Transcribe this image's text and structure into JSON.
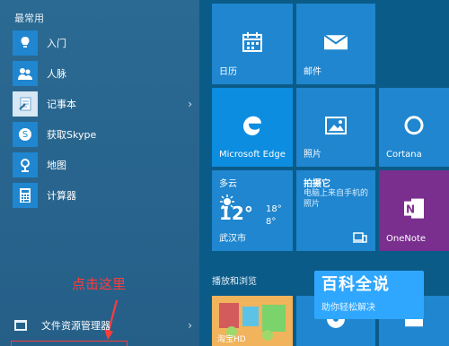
{
  "left": {
    "section_title": "最常用",
    "items": [
      {
        "label": "入门",
        "icon": "lightbulb-icon"
      },
      {
        "label": "人脉",
        "icon": "people-icon"
      },
      {
        "label": "记事本",
        "icon": "notepad-icon"
      },
      {
        "label": "获取Skype",
        "icon": "skype-icon"
      },
      {
        "label": "地图",
        "icon": "maps-icon"
      },
      {
        "label": "计算器",
        "icon": "calculator-icon"
      }
    ],
    "file_explorer": "文件资源管理器"
  },
  "annotation": {
    "text": "点击这里",
    "color": "#ff3b3b"
  },
  "tiles": {
    "calendar": {
      "label": "日历",
      "icon": "calendar-icon",
      "color": "#1f86cf"
    },
    "mail": {
      "label": "邮件",
      "icon": "mail-icon",
      "color": "#1f86cf"
    },
    "edge": {
      "label": "Microsoft Edge",
      "icon": "edge-icon",
      "color": "#0c8ddf"
    },
    "photos": {
      "label": "照片",
      "icon": "photos-icon",
      "color": "#1f86cf"
    },
    "cortana": {
      "label": "Cortana",
      "icon": "cortana-icon",
      "color": "#1f86cf"
    },
    "weather": {
      "condition": "多云",
      "temp": "12°",
      "high": "18°",
      "low": "8°",
      "city": "武汉市",
      "color": "#1f86cf"
    },
    "camera_promo": {
      "title": "拍摄它",
      "text": "电脑上来自手机的照片",
      "icon": "phone-laptop-icon",
      "color": "#1f86cf"
    },
    "onenote": {
      "label": "OneNote",
      "icon": "onenote-icon",
      "color": "#7a2f8f"
    }
  },
  "right_section_title": "播放和浏览",
  "bottom_tiles": {
    "game_label": "淘宝HD",
    "music_icon": "music-icon",
    "movie_icon": "movie-icon"
  },
  "watermark": {
    "title": "百科全说",
    "subtitle": "助你轻松解决"
  }
}
